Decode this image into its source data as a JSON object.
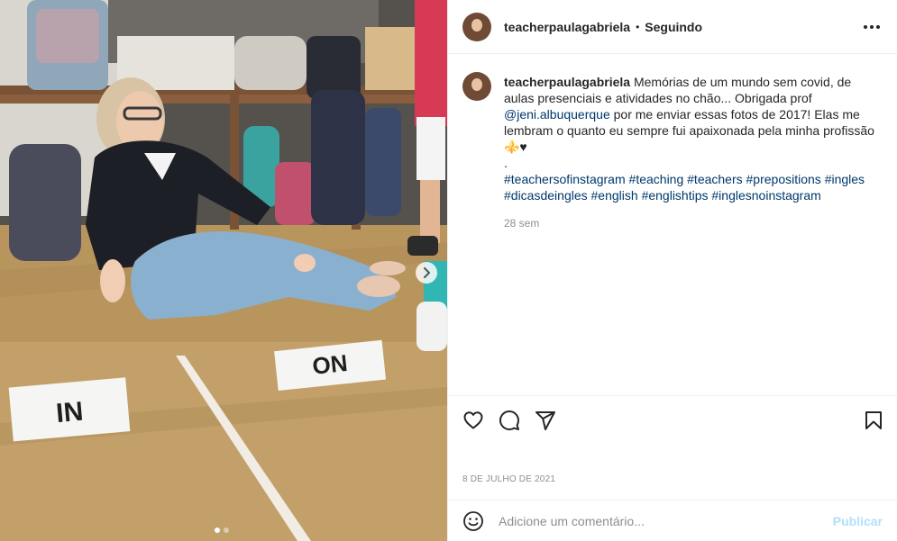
{
  "post": {
    "username": "teacherpaulagabriela",
    "separator": "•",
    "follow_status": "Seguindo",
    "caption": {
      "username": "teacherpaulagabriela",
      "text_1": " Memórias de um mundo sem covid, de aulas presenciais e atividades no chão... Obrigada prof ",
      "mention": "@jeni.albuquerque",
      "text_2": " por me enviar essas fotos de 2017! Elas me lembram o quanto eu sempre fui apaixonada pela minha profissão ⚜️♥",
      "dot": ".",
      "hashtags": [
        "#teachersofinstagram",
        "#teaching",
        "#teachers",
        "#prepositions",
        "#ingles",
        "#dicasdeingles",
        "#english",
        "#englishtips",
        "#inglesnoinstagram"
      ],
      "time_ago": "28 sem"
    },
    "date": "8 DE JULHO DE 2021",
    "comment_placeholder": "Adicione um comentário...",
    "publish_label": "Publicar"
  },
  "photo": {
    "sign_in": "IN",
    "sign_on": "ON",
    "slides_total": 2,
    "slide_active": 1
  },
  "icons": {
    "more": "more-horizontal-icon",
    "like": "heart-icon",
    "comment": "comment-bubble-icon",
    "share": "paper-plane-icon",
    "save": "bookmark-icon",
    "emoji": "smiley-icon",
    "next": "chevron-right-icon"
  }
}
